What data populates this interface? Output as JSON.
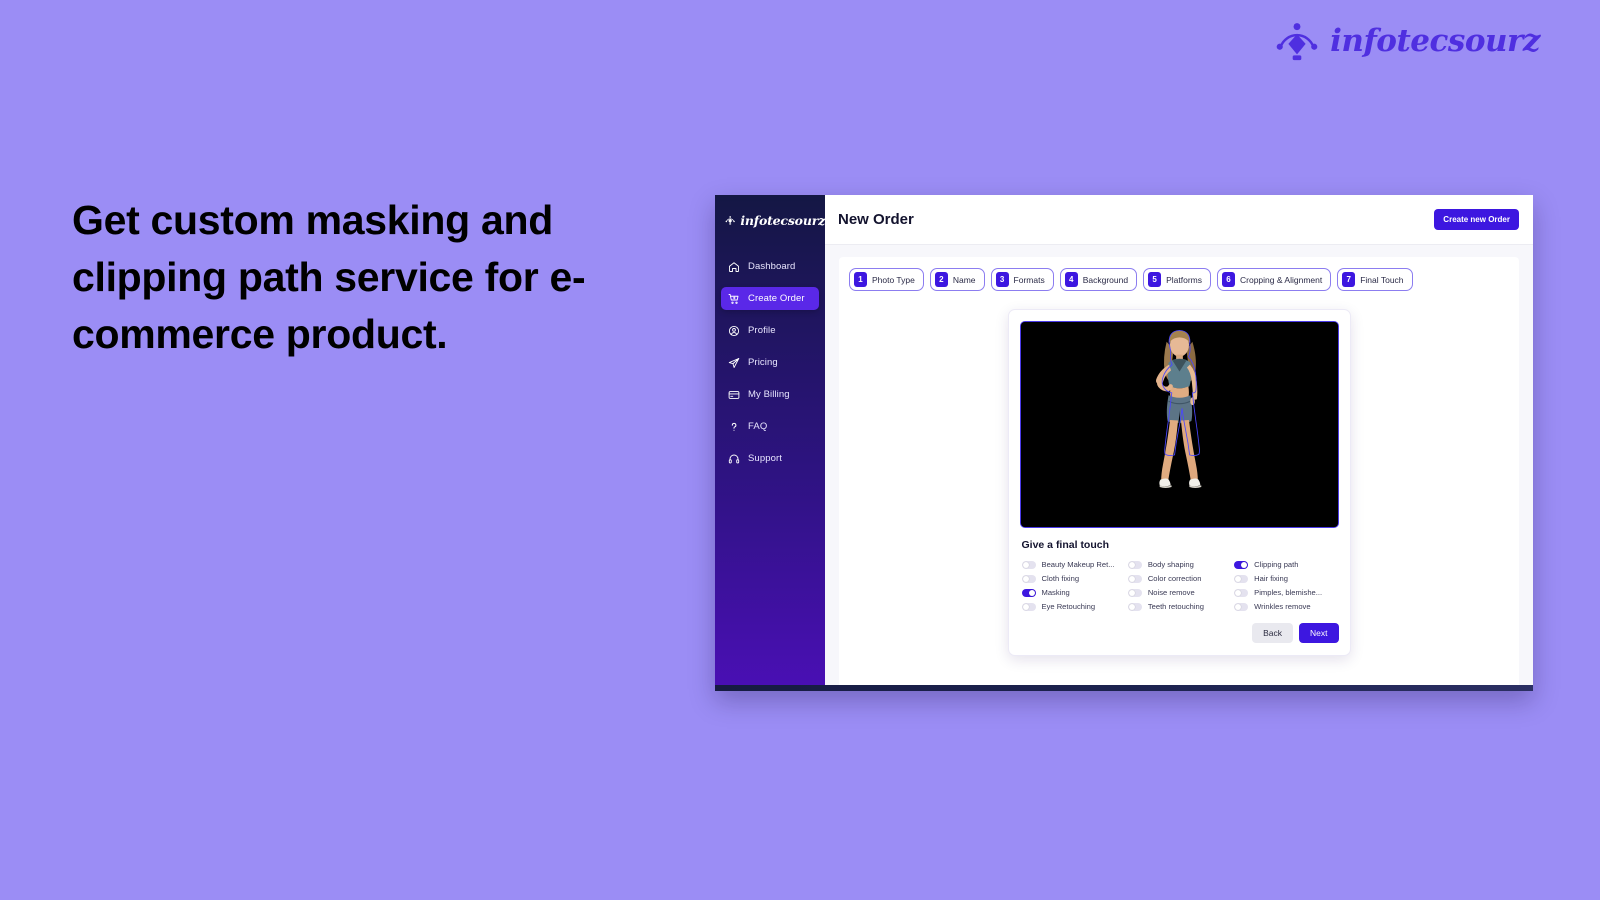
{
  "page": {
    "background_color": "#9b8df5",
    "headline": "Get custom masking and clipping path service for e-commerce product."
  },
  "brand": {
    "name": "infotecsourz",
    "mark_icon": "pen-tool-anchor-icon",
    "color": "#4f2fe0"
  },
  "app": {
    "sidebar": {
      "brand_name": "infotecsourz",
      "items": [
        {
          "label": "Dashboard",
          "icon": "home-icon",
          "active": false
        },
        {
          "label": "Create Order",
          "icon": "cart-plus-icon",
          "active": true
        },
        {
          "label": "Profile",
          "icon": "user-circle-icon",
          "active": false
        },
        {
          "label": "Pricing",
          "icon": "paper-plane-icon",
          "active": false
        },
        {
          "label": "My Billing",
          "icon": "credit-card-icon",
          "active": false
        },
        {
          "label": "FAQ",
          "icon": "question-mark-icon",
          "active": false
        },
        {
          "label": "Support",
          "icon": "headset-icon",
          "active": false
        }
      ]
    },
    "topbar": {
      "title": "New Order",
      "create_button": "Create new Order"
    },
    "stepper": [
      {
        "num": "1",
        "label": "Photo Type"
      },
      {
        "num": "2",
        "label": "Name"
      },
      {
        "num": "3",
        "label": "Formats"
      },
      {
        "num": "4",
        "label": "Background"
      },
      {
        "num": "5",
        "label": "Platforms"
      },
      {
        "num": "6",
        "label": "Cropping & Alignment"
      },
      {
        "num": "7",
        "label": "Final Touch"
      }
    ],
    "preview": {
      "photo_alt": "woman-in-teal-crop-top-and-shorts-on-black-background",
      "clipping_outline_color": "#4a3ae8",
      "section_title": "Give a final touch",
      "toggles": [
        {
          "label": "Beauty Makeup Ret...",
          "on": false
        },
        {
          "label": "Body shaping",
          "on": false
        },
        {
          "label": "Clipping path",
          "on": true
        },
        {
          "label": "Cloth fixing",
          "on": false
        },
        {
          "label": "Color correction",
          "on": false
        },
        {
          "label": "Hair fixing",
          "on": false
        },
        {
          "label": "Masking",
          "on": true
        },
        {
          "label": "Noise remove",
          "on": false
        },
        {
          "label": "Pimples, blemishe...",
          "on": false
        },
        {
          "label": "Eye Retouching",
          "on": false
        },
        {
          "label": "Teeth retouching",
          "on": false
        },
        {
          "label": "Wrinkles remove",
          "on": false
        }
      ],
      "back_button": "Back",
      "next_button": "Next"
    }
  }
}
